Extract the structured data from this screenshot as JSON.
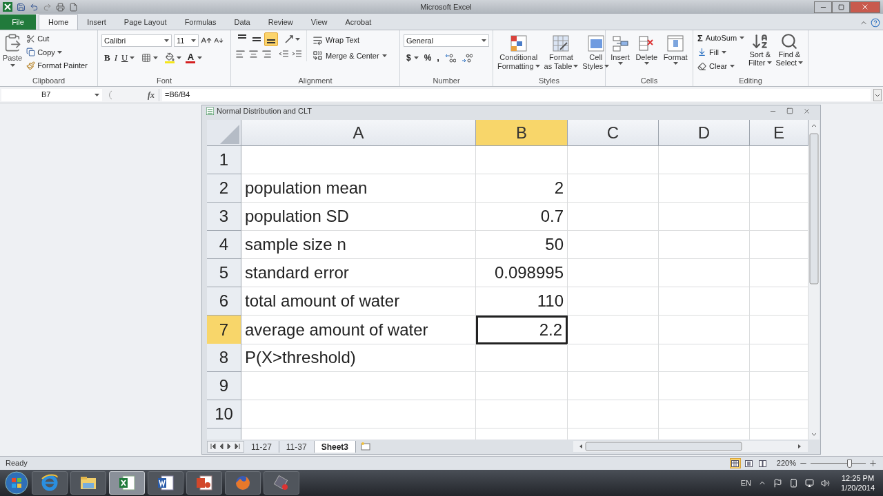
{
  "title_bar": {
    "title": "Microsoft Excel"
  },
  "ribbon_tabs": [
    {
      "label": "File",
      "kind": "file",
      "selected": false
    },
    {
      "label": "Home",
      "kind": "tab",
      "selected": true
    },
    {
      "label": "Insert",
      "kind": "tab",
      "selected": false
    },
    {
      "label": "Page Layout",
      "kind": "tab",
      "selected": false
    },
    {
      "label": "Formulas",
      "kind": "tab",
      "selected": false
    },
    {
      "label": "Data",
      "kind": "tab",
      "selected": false
    },
    {
      "label": "Review",
      "kind": "tab",
      "selected": false
    },
    {
      "label": "View",
      "kind": "tab",
      "selected": false
    },
    {
      "label": "Acrobat",
      "kind": "tab",
      "selected": false
    }
  ],
  "clipboard": {
    "paste": "Paste",
    "cut": "Cut",
    "copy": "Copy",
    "format_painter": "Format Painter",
    "label": "Clipboard"
  },
  "font": {
    "name": "Calibri",
    "size": "11",
    "bold": "B",
    "italic": "I",
    "underline": "U",
    "font_color": "A",
    "label": "Font"
  },
  "alignment": {
    "wrap_text": "Wrap Text",
    "merge": "Merge & Center",
    "label": "Alignment",
    "vertical": [
      {
        "selected": false
      },
      {
        "selected": false
      },
      {
        "selected": true
      }
    ]
  },
  "number": {
    "format": "General",
    "currency": "$",
    "percent": "%",
    "comma": ",",
    "label": "Number"
  },
  "styles": {
    "label": "Styles",
    "buttons": [
      {
        "kind": "conditional",
        "lines": [
          "Conditional",
          "Formatting"
        ]
      },
      {
        "kind": "table",
        "lines": [
          "Format",
          "as Table"
        ]
      },
      {
        "kind": "cellstyles",
        "lines": [
          "Cell",
          "Styles"
        ]
      }
    ]
  },
  "cells": {
    "label": "Cells",
    "buttons": [
      {
        "kind": "insert",
        "lines": [
          "Insert"
        ]
      },
      {
        "kind": "delete",
        "lines": [
          "Delete"
        ]
      },
      {
        "kind": "format",
        "lines": [
          "Format"
        ]
      }
    ]
  },
  "editing": {
    "label": "Editing",
    "autosum_symbol": "Σ",
    "autosum": "AutoSum",
    "fill": "Fill",
    "clear": "Clear",
    "sort": [
      "Sort &",
      "Filter"
    ],
    "find": [
      "Find &",
      "Select"
    ]
  },
  "formula_bar": {
    "name_box": "B7",
    "fx": "fx",
    "formula": "=B6/B4"
  },
  "workbook": {
    "title": "Normal Distribution and CLT",
    "columns": [
      {
        "label": "A",
        "selected": false
      },
      {
        "label": "B",
        "selected": true
      },
      {
        "label": "C",
        "selected": false
      },
      {
        "label": "D",
        "selected": false
      },
      {
        "label": "E",
        "selected": false
      }
    ],
    "rows": [
      {
        "number": "1",
        "selected": false
      },
      {
        "number": "2",
        "selected": false,
        "label": "population mean",
        "value": "2"
      },
      {
        "number": "3",
        "selected": false,
        "label": "population SD",
        "value": "0.7"
      },
      {
        "number": "4",
        "selected": false,
        "label": "sample size n",
        "value": "50"
      },
      {
        "number": "5",
        "selected": false,
        "label": "standard error",
        "value": "0.098995"
      },
      {
        "number": "6",
        "selected": false,
        "label": "total amount of water",
        "value": "110"
      },
      {
        "number": "7",
        "selected": true,
        "label": "average amount of water",
        "value": "2.2"
      },
      {
        "number": "8",
        "selected": false,
        "label": "P(X>threshold)"
      },
      {
        "number": "9",
        "selected": false
      },
      {
        "number": "10",
        "selected": false
      }
    ],
    "sheets": [
      {
        "label": "11-27",
        "selected": false
      },
      {
        "label": "11-37",
        "selected": false
      },
      {
        "label": "Sheet3",
        "selected": true
      }
    ]
  },
  "status_bar": {
    "status": "Ready",
    "zoom": "220%",
    "level": 0.7,
    "views": [
      {
        "kind": "normal",
        "selected": true
      },
      {
        "kind": "layout",
        "selected": false
      },
      {
        "kind": "pagebreak",
        "selected": false
      }
    ]
  },
  "taskbar": {
    "apps": [
      {
        "kind": "ie",
        "selected": false
      },
      {
        "kind": "explorer",
        "selected": false
      },
      {
        "kind": "excel",
        "selected": true
      },
      {
        "kind": "word",
        "selected": false
      },
      {
        "kind": "powerpoint",
        "selected": false
      },
      {
        "kind": "firefox",
        "selected": false
      },
      {
        "kind": "tool",
        "selected": false
      }
    ],
    "language": "EN",
    "time": "12:25 PM",
    "date": "1/20/2014"
  }
}
